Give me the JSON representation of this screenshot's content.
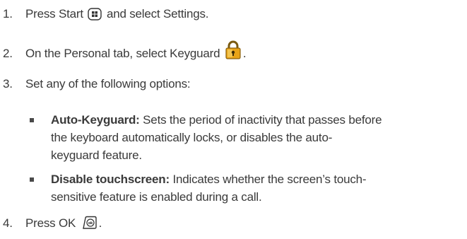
{
  "steps": [
    {
      "num": "1.",
      "before": "Press Start",
      "after": "and select Settings.",
      "icon": "start-key-icon"
    },
    {
      "num": "2.",
      "before": "On the Personal tab, select Keyguard",
      "after": ".",
      "icon": "padlock-icon"
    },
    {
      "num": "3.",
      "text": "Set any of the following options:"
    },
    {
      "num": "4.",
      "before": "Press OK",
      "after": ".",
      "icon": "ok-key-icon"
    }
  ],
  "options": [
    {
      "term": "Auto-Keyguard:",
      "lines": [
        "Sets the period of inactivity that passes before",
        "the keyboard automatically locks, or disables the auto-",
        "keyguard feature."
      ]
    },
    {
      "term": "Disable touchscreen:",
      "lines": [
        "Indicates whether the screen’s touch-",
        "sensitive feature is enabled during a call."
      ]
    }
  ],
  "colors": {
    "text": "#3a3a3a",
    "padlock_gold": "#e8a317"
  }
}
